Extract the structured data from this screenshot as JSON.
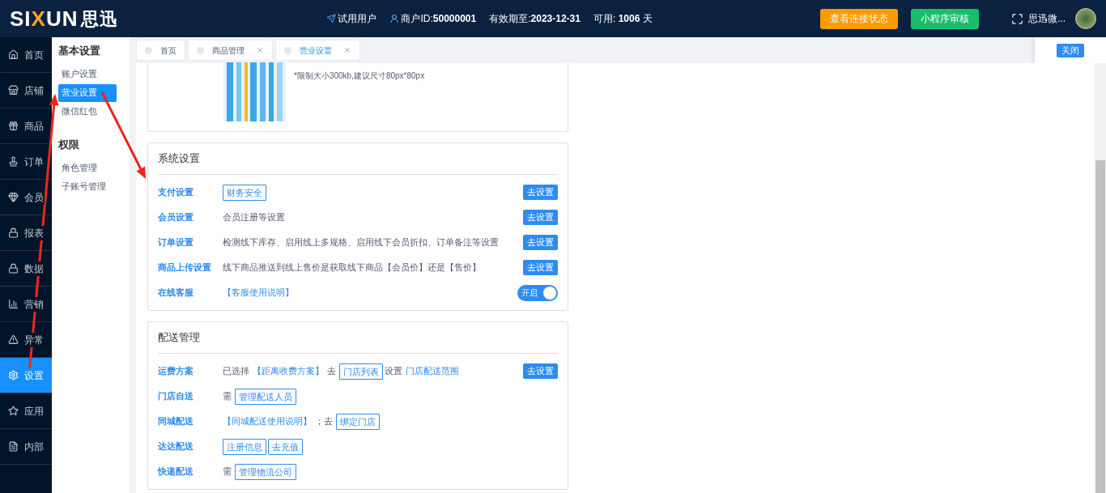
{
  "topbar": {
    "brand": [
      {
        "text": "SI"
      },
      {
        "text": "X",
        "color": "#f5a623"
      },
      {
        "text": "UN"
      }
    ],
    "brand_cn": "思迅",
    "trial_user": "试用用户",
    "merchant_label": "商户ID:",
    "merchant_id": "50000001",
    "expiry_label": "有效期至:",
    "expiry": "2023-12-31",
    "available_label": "可用:",
    "available_days": "1006",
    "available_unit": "天",
    "buttons": [
      {
        "label": "查看连接状态",
        "color": "#ff9900"
      },
      {
        "label": "小程序审核",
        "color": "#19be6b"
      }
    ],
    "username": "思迅微..."
  },
  "nav": [
    {
      "label": "首页",
      "selected": false
    },
    {
      "label": "店铺",
      "selected": false
    },
    {
      "label": "商品",
      "selected": false
    },
    {
      "label": "订单",
      "selected": false
    },
    {
      "label": "会员",
      "selected": false
    },
    {
      "label": "报表",
      "selected": false
    },
    {
      "label": "数据",
      "selected": false
    },
    {
      "label": "营销",
      "selected": false
    },
    {
      "label": "异常",
      "selected": false
    },
    {
      "label": "设置",
      "selected": true
    },
    {
      "label": "应用",
      "selected": false
    },
    {
      "label": "内部",
      "selected": false
    }
  ],
  "submenu": [
    {
      "title": "基本设置",
      "items": [
        {
          "label": "账户设置",
          "selected": false
        },
        {
          "label": "营业设置",
          "selected": true
        },
        {
          "label": "微信红包",
          "selected": false
        }
      ]
    },
    {
      "title": "权限",
      "items": [
        {
          "label": "角色管理",
          "selected": false
        },
        {
          "label": "子账号管理",
          "selected": false
        }
      ]
    }
  ],
  "tabs": [
    {
      "label": "首页",
      "selected": false,
      "closable": false
    },
    {
      "label": "商品管理",
      "selected": false,
      "closable": true
    },
    {
      "label": "营业设置",
      "selected": true,
      "closable": true
    }
  ],
  "close_button": "关闭",
  "upload_hint": "*限制大小300kb,建议尺寸80px*80px",
  "sections": [
    {
      "title": "系统设置",
      "rows": [
        {
          "label": "支付设置",
          "content": [
            {
              "kind": "tag",
              "text": "财务安全"
            }
          ],
          "action": {
            "kind": "button",
            "label": "去设置"
          }
        },
        {
          "label": "会员设置",
          "content": [
            {
              "kind": "text",
              "text": "会员注册等设置"
            }
          ],
          "action": {
            "kind": "button",
            "label": "去设置"
          }
        },
        {
          "label": "订单设置",
          "content": [
            {
              "kind": "text",
              "text": "检测线下库存、启用线上多规格、启用线下会员折扣、订单备注等设置"
            }
          ],
          "action": {
            "kind": "button",
            "label": "去设置"
          }
        },
        {
          "label": "商品上传设置",
          "content": [
            {
              "kind": "text",
              "text": "线下商品推送到线上售价是获取线下商品【会员价】还是【售价】"
            }
          ],
          "action": {
            "kind": "button",
            "label": "去设置"
          }
        },
        {
          "label": "在线客服",
          "content": [
            {
              "kind": "link",
              "text": "【客服使用说明】"
            }
          ],
          "action": {
            "kind": "toggle",
            "label": "开启",
            "on": true
          }
        }
      ]
    },
    {
      "title": "配送管理",
      "rows": [
        {
          "label": "运费方案",
          "content": [
            {
              "kind": "text",
              "text": "已选择"
            },
            {
              "kind": "link",
              "text": "【距离收费方案】"
            },
            {
              "kind": "text",
              "text": "去"
            },
            {
              "kind": "tag",
              "text": "门店列表"
            },
            {
              "kind": "text",
              "text": "设置"
            },
            {
              "kind": "link",
              "text": "门店配送范围"
            }
          ],
          "action": {
            "kind": "button",
            "label": "去设置"
          }
        },
        {
          "label": "门店自送",
          "content": [
            {
              "kind": "text",
              "text": "需"
            },
            {
              "kind": "tag",
              "text": "管理配送人员"
            }
          ]
        },
        {
          "label": "同城配送",
          "content": [
            {
              "kind": "link",
              "text": "【同城配送使用说明】"
            },
            {
              "kind": "text",
              "text": "；去"
            },
            {
              "kind": "tag",
              "text": "绑定门店"
            }
          ]
        },
        {
          "label": "达达配送",
          "content": [
            {
              "kind": "tag",
              "text": "注册信息"
            },
            {
              "kind": "tag",
              "text": "去充值"
            }
          ]
        },
        {
          "label": "快递配送",
          "content": [
            {
              "kind": "text",
              "text": "需"
            },
            {
              "kind": "tag",
              "text": "管理物流公司"
            }
          ]
        }
      ]
    }
  ]
}
